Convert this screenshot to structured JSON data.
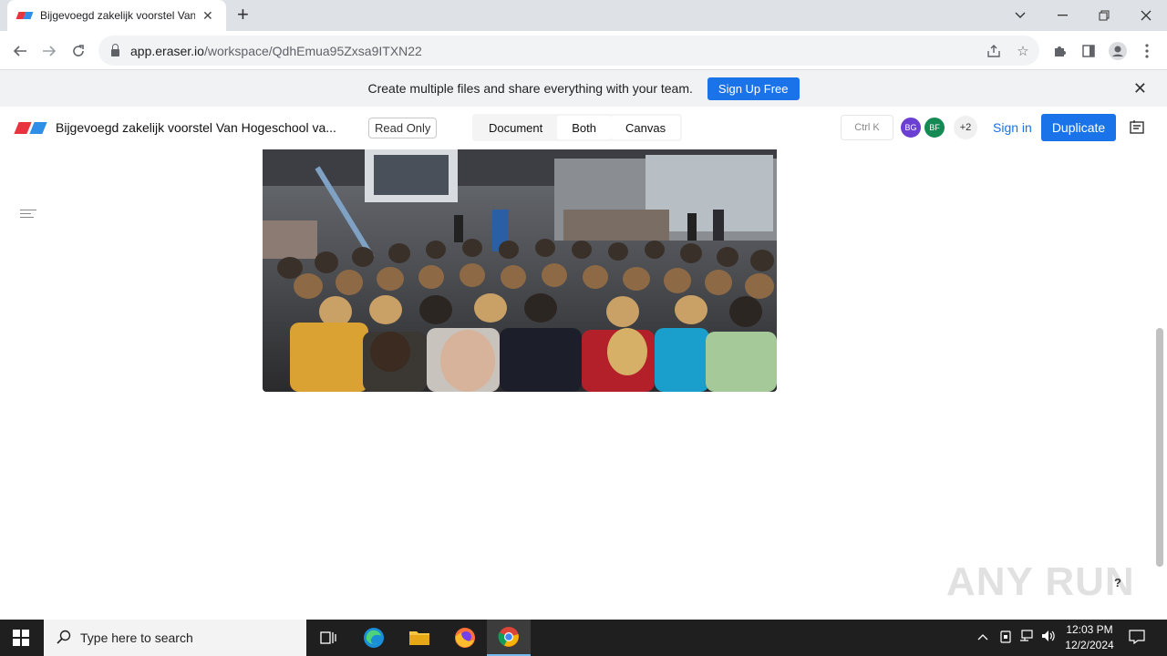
{
  "browser": {
    "tab_title": "Bijgevoegd zakelijk voorstel Van",
    "url_host": "app.eraser.io",
    "url_path": "/workspace/QdhEmua95Zxsa9ITXN22"
  },
  "banner": {
    "text": "Create multiple files and share everything with your team.",
    "button": "Sign Up Free"
  },
  "appbar": {
    "title": "Bijgevoegd zakelijk voorstel Van Hogeschool va...",
    "read_only": "Read Only",
    "views": [
      "Document",
      "Both",
      "Canvas"
    ],
    "shortcut": "Ctrl K",
    "avatars": [
      {
        "initials": "BG",
        "color": "#6b3fd1"
      },
      {
        "initials": "BF",
        "color": "#168a55"
      }
    ],
    "more_count": "+2",
    "sign_in": "Sign in",
    "duplicate": "Duplicate"
  },
  "watermark": "ANY RUN",
  "help": "?",
  "taskbar": {
    "search_placeholder": "Type here to search",
    "time": "12:03 PM",
    "date": "12/2/2024"
  },
  "colors": {
    "accent": "#1a73e8",
    "taskbar": "#1f1f1f"
  }
}
